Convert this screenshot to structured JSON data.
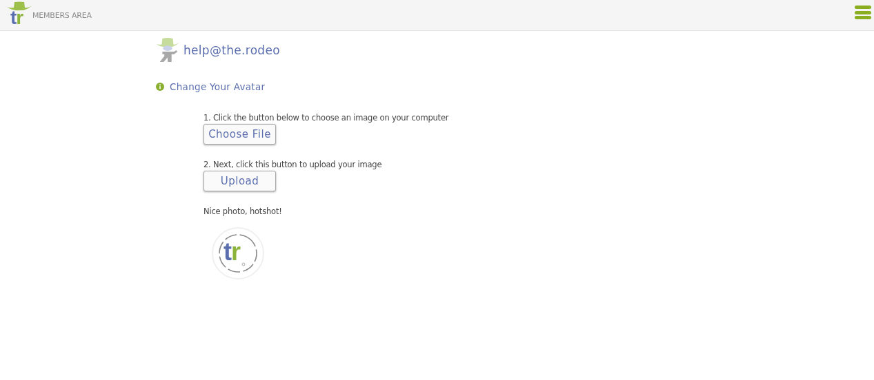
{
  "header": {
    "logo_letters": [
      {
        "text": "t",
        "color": "#5b6eae"
      },
      {
        "text": "r",
        "color": "#8db43a"
      }
    ],
    "title": "MEMBERS AREA"
  },
  "user": {
    "email": "help@the.rodeo"
  },
  "section": {
    "title": "Change Your Avatar"
  },
  "steps": [
    {
      "instruction": "1. Click the button below to choose an image on your computer",
      "button": "Choose File"
    },
    {
      "instruction": "2. Next, click this button to upload your image",
      "button": "Upload"
    }
  ],
  "message": "Nice photo, hotshot!",
  "avatar": {
    "letters": [
      {
        "text": "t",
        "color": "#5b6eae"
      },
      {
        "text": "r",
        "color": "#8db43a"
      }
    ]
  }
}
